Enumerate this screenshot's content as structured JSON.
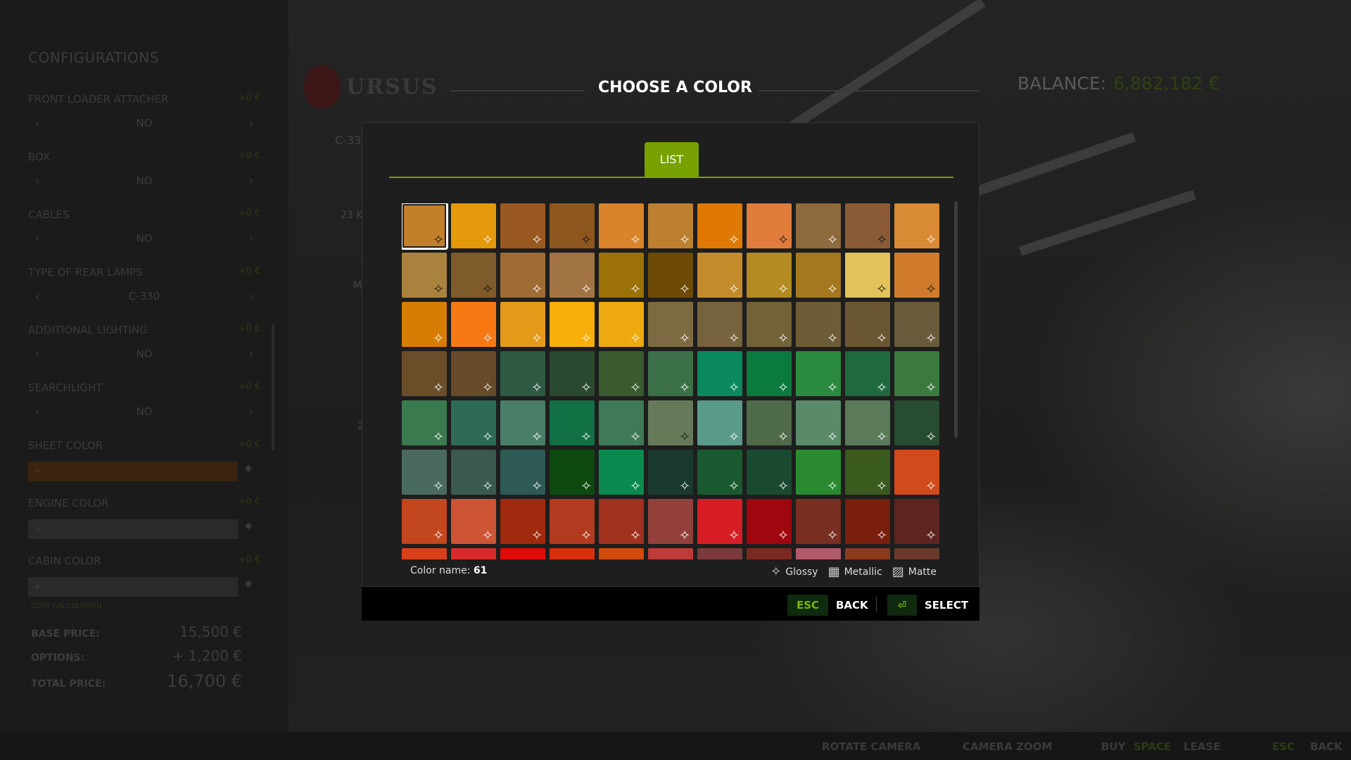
{
  "sidebar": {
    "title": "CONFIGURATIONS",
    "items": [
      {
        "label": "FRONT LOADER ATTACHER",
        "price": "+0 €",
        "value": "NO",
        "prev": "‹",
        "next": "›"
      },
      {
        "label": "BOX",
        "price": "+0 €",
        "value": "NO",
        "prev": "‹",
        "next": "›"
      },
      {
        "label": "CABLES",
        "price": "+0 €",
        "value": "NO",
        "prev": "‹",
        "next": "›"
      },
      {
        "label": "TYPE OF REAR LAMPS",
        "price": "+0 €",
        "value": "C-330",
        "prev": "‹",
        "next": "›"
      },
      {
        "label": "ADDITIONAL LIGHTING",
        "price": "+0 €",
        "value": "NO",
        "prev": "‹",
        "next": "›"
      },
      {
        "label": "SEARCHLIGHT",
        "price": "+0 €",
        "value": "NO",
        "prev": "‹",
        "next": "›"
      }
    ],
    "color_items": [
      {
        "label": "SHEET COLOR",
        "price": "+0 €",
        "color": "#3a2410"
      },
      {
        "label": "ENGINE COLOR",
        "price": "+0 €",
        "color": "#2a2a2a"
      },
      {
        "label": "CABIN COLOR",
        "price": "+0 €",
        "color": "#2a2a2a"
      }
    ],
    "cost_title": "COST CALCULATION",
    "cost": {
      "base_label": "BASE PRICE:",
      "base": "15,500 €",
      "options_label": "OPTIONS:",
      "options": "+ 1,200 €",
      "total_label": "TOTAL PRICE:",
      "total": "16,700 €"
    }
  },
  "header": {
    "brand": "URSUS",
    "dialog_title": "CHOOSE A COLOR",
    "balance_label": "BALANCE:",
    "balance": "6,882,182 €"
  },
  "ghost": {
    "model": "C-33",
    "stat1": "23 K",
    "stat2": "M",
    "stat3": "2"
  },
  "modal": {
    "tab": "LIST",
    "color_name_label": "Color name:",
    "color_name": "61",
    "legend": {
      "glossy": "Glossy",
      "metallic": "Metallic",
      "matte": "Matte"
    },
    "finish_icons": {
      "glossy": "sparkle-icon",
      "metallic": "grid-circle-icon",
      "matte": "hatch-icon"
    },
    "selected_index": 0,
    "swatches": [
      "#c3802b",
      "#e49a0a",
      "#9a5920",
      "#8e561f",
      "#d9832a",
      "#bd8030",
      "#e07805",
      "#e07c3c",
      "#8e6a3c",
      "#8a5b35",
      "#d98a35",
      "#a9823e",
      "#7f5a2b",
      "#9f6c35",
      "#a37443",
      "#9c7208",
      "#6e4a07",
      "#c48b2b",
      "#b48a22",
      "#a4781e",
      "#e2c25b",
      "#cf7b2b",
      "#d77d05",
      "#f87913",
      "#e59a1a",
      "#f8af0b",
      "#eea910",
      "#7d6a42",
      "#76623c",
      "#726238",
      "#6e5c36",
      "#6a5632",
      "#6a5a3c",
      "#6a4e2a",
      "#664a2a",
      "#2e5a44",
      "#2a4a30",
      "#3a5a30",
      "#3b7048",
      "#0a8a5e",
      "#0a7a3e",
      "#2a8a3e",
      "#1e6a3e",
      "#3a7a3e",
      "#3a7a4e",
      "#2e6a58",
      "#4a7e68",
      "#127045",
      "#3f7a58",
      "#667a5a",
      "#5a9a8a",
      "#4e6a48",
      "#5a8a68",
      "#5a7a5a",
      "#274c30",
      "#4a6a60",
      "#3a5a4e",
      "#2e5a54",
      "#0e4a10",
      "#0a8a4e",
      "#1a3a30",
      "#1a5a30",
      "#1a4a30",
      "#2a8a30",
      "#3a5a1e",
      "#d04a1c",
      "#c2461e",
      "#ce5436",
      "#a02a0e",
      "#b23a1e",
      "#a0321e",
      "#94403a",
      "#d81e24",
      "#a0060e",
      "#782e20",
      "#7a1e0e",
      "#5e2420",
      "#d8401a",
      "#d82a2a",
      "#e00a0a",
      "#d8300a",
      "#d04a0a",
      "#c03a3a",
      "#7a3a3a",
      "#7a2a20",
      "#b05a6a",
      "#8a3a1e",
      "#6a3a2a"
    ]
  },
  "modal_footer": {
    "back_key": "ESC",
    "back": "BACK",
    "select_key": "⏎",
    "select": "SELECT"
  },
  "footer": {
    "rotate": "ROTATE CAMERA",
    "zoom": "CAMERA ZOOM",
    "buy": "BUY",
    "lease_key": "SPACE",
    "lease": "LEASE",
    "back_key": "ESC",
    "back": "BACK"
  }
}
